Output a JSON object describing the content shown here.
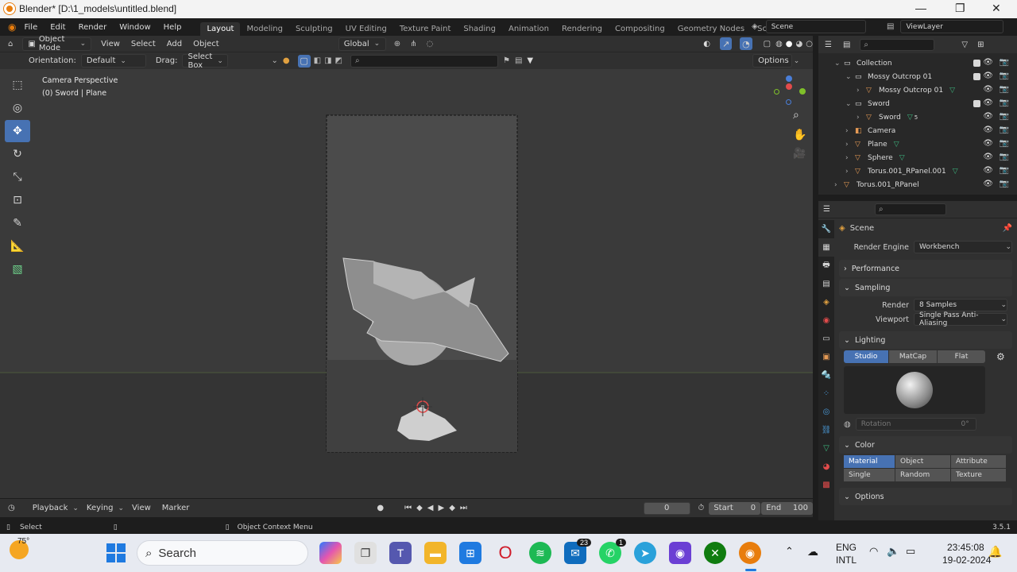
{
  "title_bar": {
    "title": "Blender* [D:\\1_models\\untitled.blend]",
    "minimize": "—",
    "maximize": "❐",
    "close": "✕"
  },
  "menu": {
    "items": [
      "File",
      "Edit",
      "Render",
      "Window",
      "Help"
    ],
    "workspaces": [
      "Layout",
      "Modeling",
      "Sculpting",
      "UV Editing",
      "Texture Paint",
      "Shading",
      "Animation",
      "Rendering",
      "Compositing",
      "Geometry Nodes",
      "Scripting"
    ],
    "active_workspace": "Layout",
    "scene": "Scene",
    "view_layer": "ViewLayer"
  },
  "viewport": {
    "mode": "Object Mode",
    "menus": [
      "View",
      "Select",
      "Add",
      "Object"
    ],
    "transform_orientation": "Global",
    "orientation_label": "Orientation:",
    "orientation_value": "Default",
    "drag_label": "Drag:",
    "drag_value": "Select Box",
    "options_label": "Options",
    "overlay_title": "Camera Perspective",
    "overlay_subtitle": "(0) Sword | Plane"
  },
  "outliner": {
    "rows": [
      {
        "label": "Collection",
        "indent": 1,
        "type": "collection"
      },
      {
        "label": "Mossy Outcrop 01",
        "indent": 2,
        "type": "collection"
      },
      {
        "label": "Mossy Outcrop 01",
        "indent": 3,
        "type": "mesh"
      },
      {
        "label": "Sword",
        "indent": 2,
        "type": "collection"
      },
      {
        "label": "Sword",
        "indent": 3,
        "type": "mesh"
      },
      {
        "label": "Camera",
        "indent": 2,
        "type": "camera"
      },
      {
        "label": "Plane",
        "indent": 2,
        "type": "mesh"
      },
      {
        "label": "Sphere",
        "indent": 2,
        "type": "mesh"
      },
      {
        "label": "Torus.001_RPanel.001",
        "indent": 2,
        "type": "mesh"
      },
      {
        "label": "Torus.001_RPanel",
        "indent": 1,
        "type": "mesh"
      }
    ],
    "sword_count": "5"
  },
  "properties": {
    "context": "Scene",
    "render_engine_label": "Render Engine",
    "render_engine": "Workbench",
    "performance": "Performance",
    "sampling": "Sampling",
    "render_label": "Render",
    "render_value": "8 Samples",
    "viewport_label": "Viewport",
    "viewport_value": "Single Pass Anti-Aliasing",
    "lighting": "Lighting",
    "lighting_modes": [
      "Studio",
      "MatCap",
      "Flat"
    ],
    "rotation_label": "Rotation",
    "rotation_value": "0°",
    "color": "Color",
    "color_modes": [
      "Material",
      "Object",
      "Attribute",
      "Single",
      "Random",
      "Texture"
    ],
    "options": "Options"
  },
  "timeline": {
    "menus": [
      "Playback",
      "Keying",
      "View",
      "Marker"
    ],
    "current_frame": "0",
    "start_label": "Start",
    "start": "0",
    "end_label": "End",
    "end": "100"
  },
  "status_bar": {
    "left": "Select",
    "middle": "Object Context Menu",
    "version": "3.5.1"
  },
  "taskbar": {
    "weather": "75°",
    "search": "Search",
    "lang1": "ENG",
    "lang2": "INTL",
    "time": "23:45:08",
    "date": "19-02-2024",
    "mail_badge": "23",
    "whatsapp_badge": "1"
  },
  "colors": {
    "accent": "#4772b3",
    "blender_orange": "#e87d0d",
    "outliner_mesh": "#e59a55",
    "green_data": "#3db77f"
  }
}
